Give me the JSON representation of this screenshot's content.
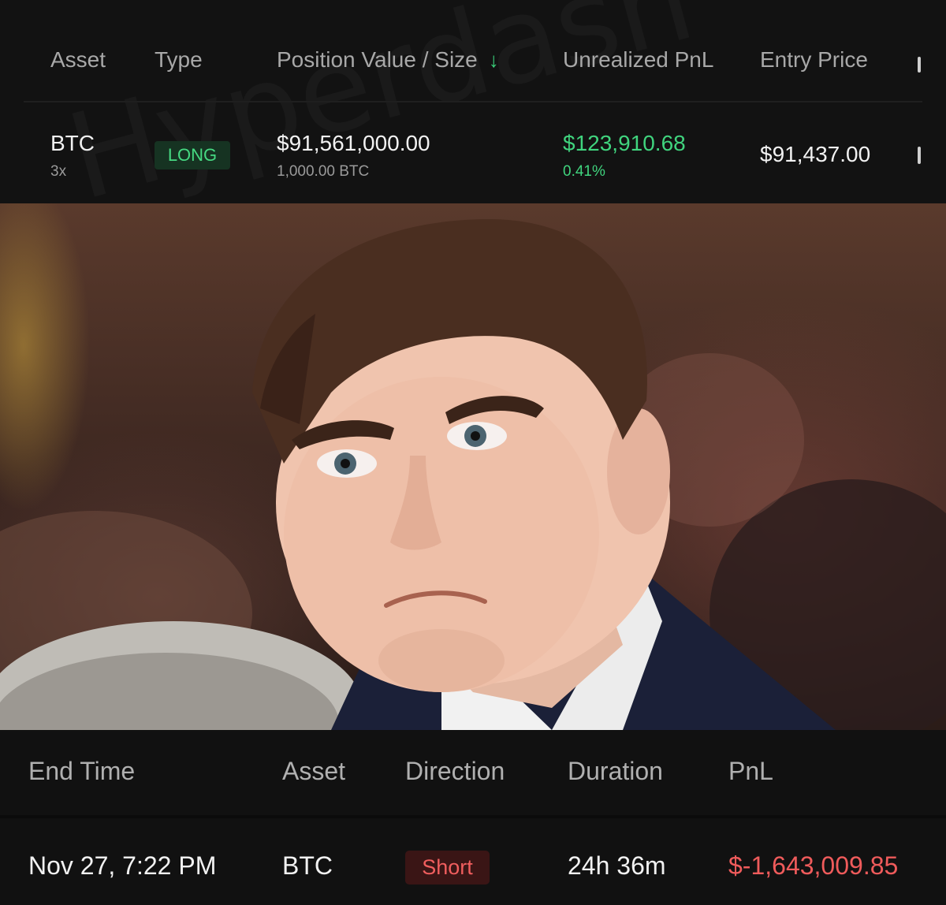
{
  "positions_table": {
    "headers": {
      "asset": "Asset",
      "type": "Type",
      "position_value_size": "Position Value / Size",
      "sort_indicator": "↓",
      "unrealized_pnl": "Unrealized PnL",
      "entry_price": "Entry Price"
    },
    "row": {
      "asset": "BTC",
      "leverage": "3x",
      "type": "LONG",
      "position_value": "$91,561,000.00",
      "size": "1,000.00 BTC",
      "unrealized_pnl": "$123,910.68",
      "unrealized_pnl_pct": "0.41%",
      "entry_price": "$91,437.00"
    }
  },
  "watermark_text": "Hyperdash",
  "photo": {
    "description_icon": "person-photo"
  },
  "trade_history": {
    "headers": {
      "end_time": "End Time",
      "asset": "Asset",
      "direction": "Direction",
      "duration": "Duration",
      "pnl": "PnL"
    },
    "row": {
      "end_time": "Nov 27, 7:22 PM",
      "asset": "BTC",
      "direction": "Short",
      "duration": "24h 36m",
      "pnl": "$-1,643,009.85"
    }
  },
  "colors": {
    "positive": "#40d47e",
    "negative": "#ef5b5b",
    "background": "#121212"
  }
}
